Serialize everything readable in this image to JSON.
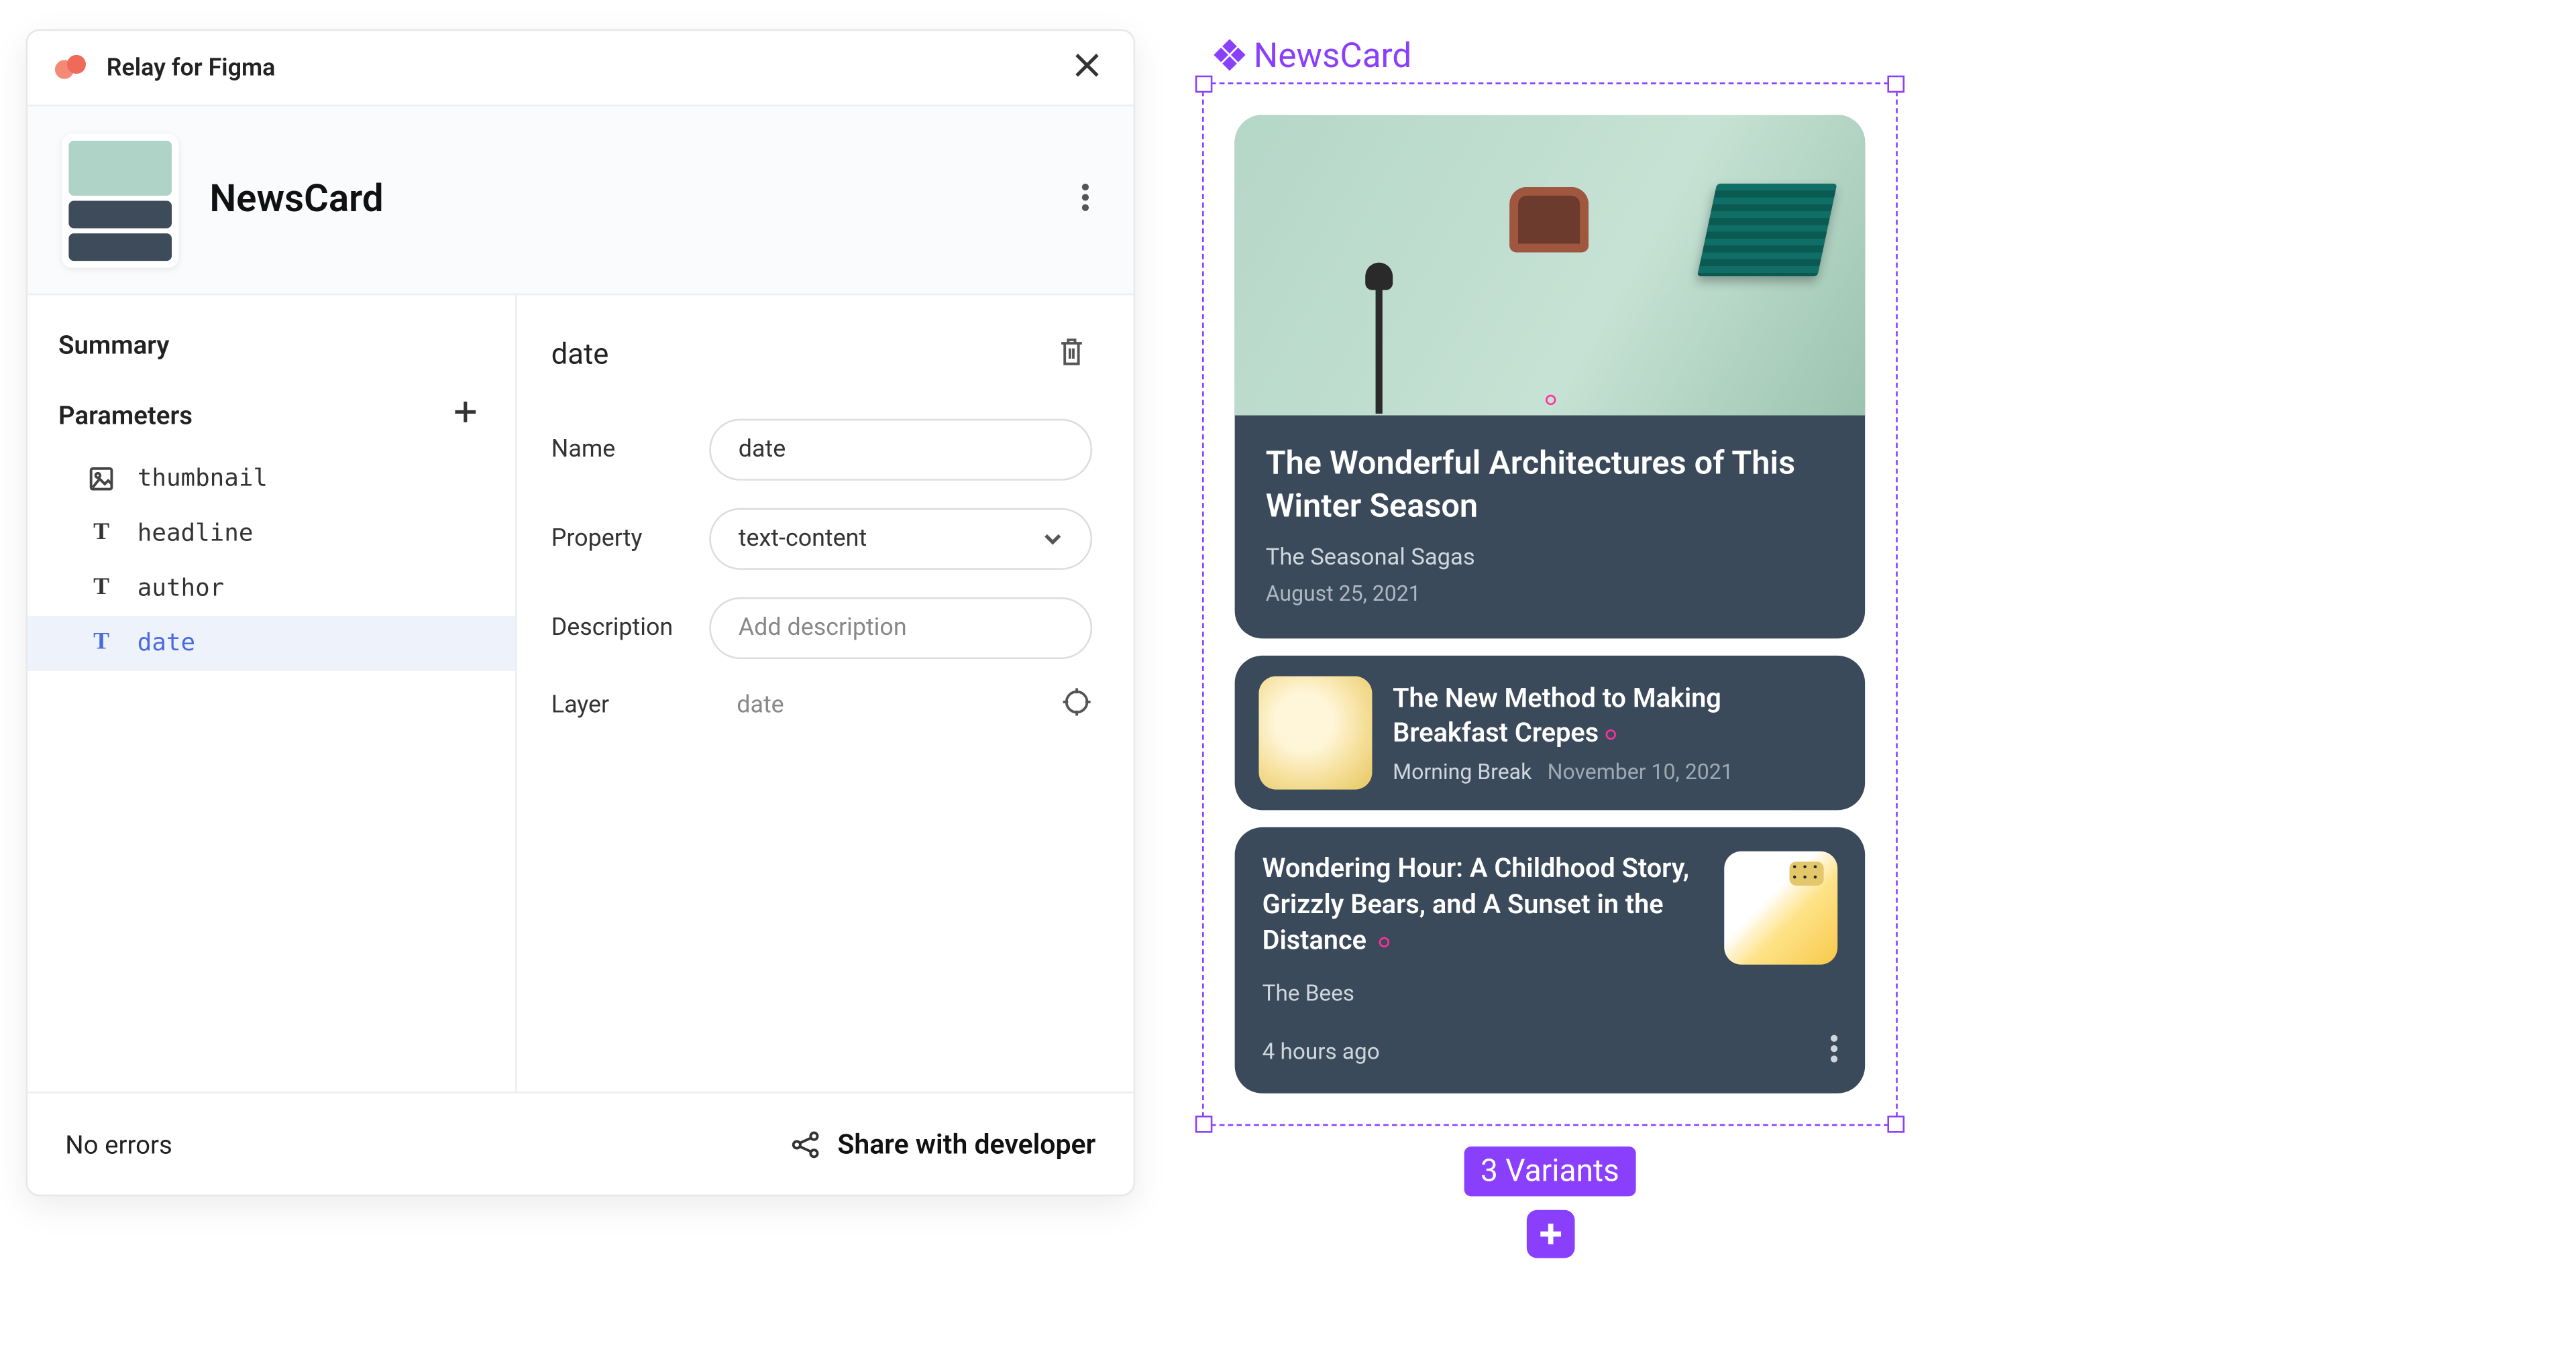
{
  "plugin": {
    "title": "Relay for Figma",
    "component_name": "NewsCard"
  },
  "left": {
    "summary": "Summary",
    "parameters": "Parameters",
    "params": [
      {
        "kind": "image",
        "name": "thumbnail"
      },
      {
        "kind": "text",
        "name": "headline"
      },
      {
        "kind": "text",
        "name": "author"
      },
      {
        "kind": "text",
        "name": "date",
        "selected": true
      }
    ]
  },
  "detail": {
    "title": "date",
    "name_label": "Name",
    "name_value": "date",
    "property_label": "Property",
    "property_value": "text-content",
    "description_label": "Description",
    "description_placeholder": "Add description",
    "layer_label": "Layer",
    "layer_value": "date"
  },
  "footer": {
    "errors": "No errors",
    "share": "Share with developer"
  },
  "canvas": {
    "component_label": "NewsCard",
    "variants_label": "3 Variants",
    "cards": {
      "hero": {
        "headline": "The Wonderful Architectures of This Winter Season",
        "author": "The Seasonal Sagas",
        "date": "August 25, 2021"
      },
      "row2": {
        "headline": "The New Method to Making Breakfast Crepes",
        "author": "Morning Break",
        "date": "November 10, 2021"
      },
      "row3": {
        "headline": "Wondering Hour: A Childhood Story, Grizzly Bears, and A Sunset in the Distance",
        "author": "The Bees",
        "time": "4 hours ago"
      }
    }
  }
}
